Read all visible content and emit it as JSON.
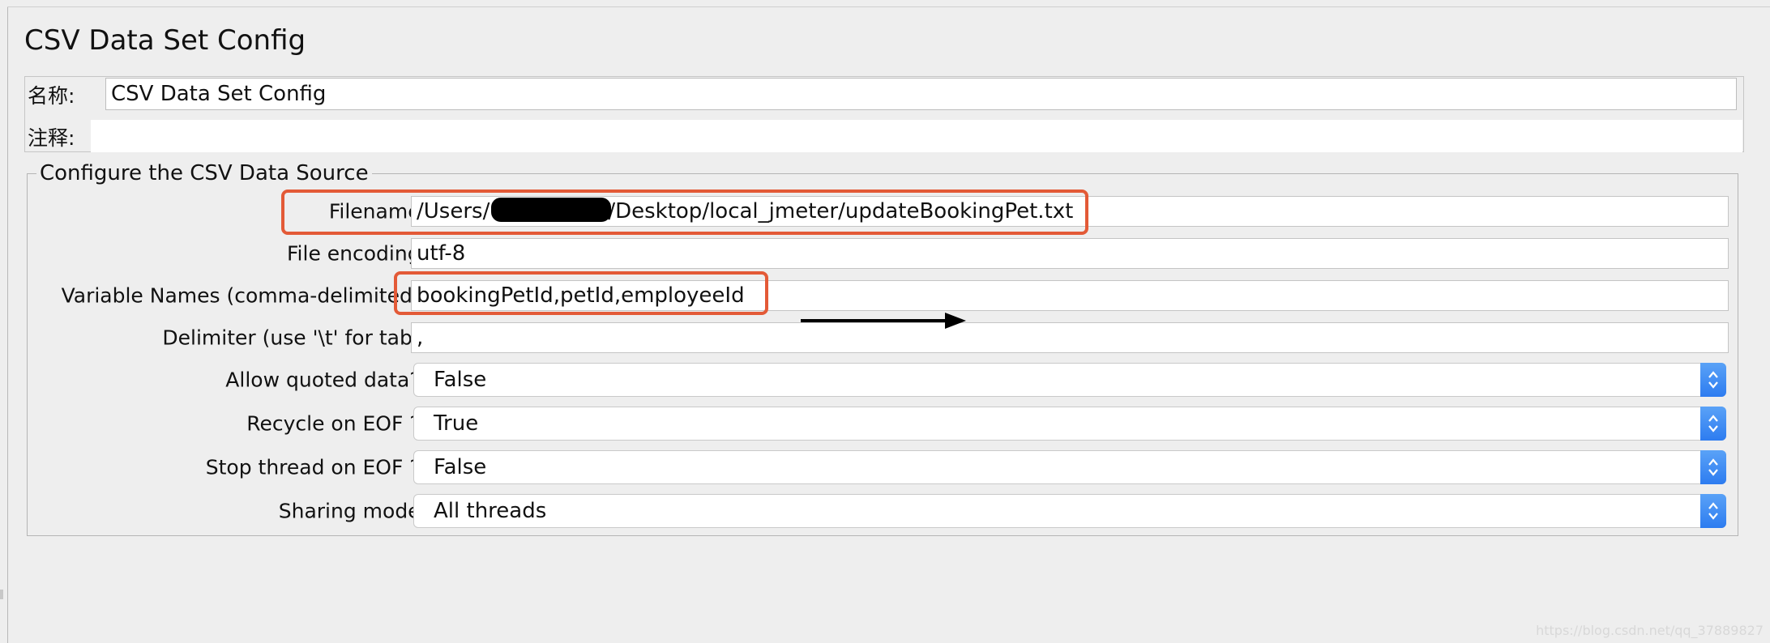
{
  "panel": {
    "title": "CSV Data Set Config"
  },
  "meta": {
    "name_label": "名称:",
    "name_value": "CSV Data Set Config",
    "comment_label": "注释:",
    "comment_value": ""
  },
  "group": {
    "legend": "Configure the CSV Data Source"
  },
  "fields": {
    "filename_label": "Filename:",
    "filename_value": "/Users/",
    "filename_value_rest": "/Desktop/local_jmeter/updateBookingPet.txt",
    "encoding_label": "File encoding:",
    "encoding_value": "utf-8",
    "variables_label": "Variable Names (comma-delimited):",
    "variables_value": "bookingPetId,petId,employeeId",
    "delimiter_label": "Delimiter (use '\\t' for tab):",
    "delimiter_value": ","
  },
  "selects": {
    "quoted_label": "Allow quoted data?:",
    "quoted_value": "False",
    "recycle_label": "Recycle on EOF ?:",
    "recycle_value": "True",
    "stop_label": "Stop thread on EOF ?:",
    "stop_value": "False",
    "sharing_label": "Sharing mode:",
    "sharing_value": "All threads"
  },
  "annotations": {
    "highlight_color": "#e35a37",
    "arrow_color": "#000000"
  },
  "watermark": "https://blog.csdn.net/qq_37889827"
}
